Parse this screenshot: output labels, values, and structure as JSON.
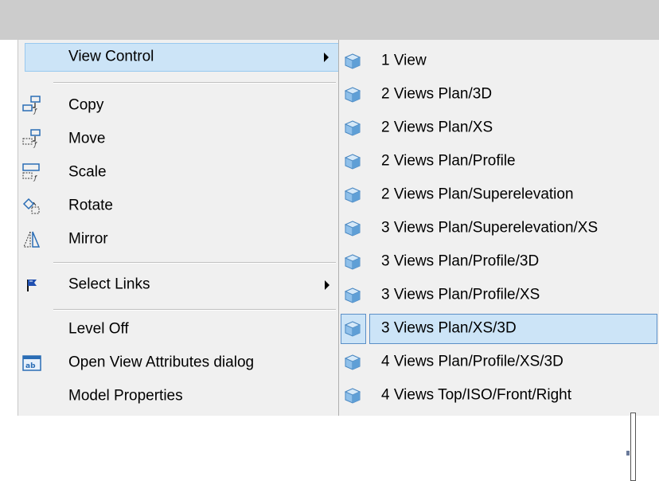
{
  "menu": {
    "items": [
      {
        "label": "View Control",
        "icon": "none",
        "submenu": true,
        "highlight": true
      },
      {
        "label": "Copy",
        "icon": "copy-icon"
      },
      {
        "label": "Move",
        "icon": "move-icon"
      },
      {
        "label": "Scale",
        "icon": "scale-icon"
      },
      {
        "label": "Rotate",
        "icon": "rotate-icon"
      },
      {
        "label": "Mirror",
        "icon": "mirror-icon"
      },
      {
        "label": "Select Links",
        "icon": "select-links-icon",
        "submenu": true
      },
      {
        "label": "Level Off",
        "icon": "none"
      },
      {
        "label": "Open View Attributes dialog",
        "icon": "view-attributes-icon"
      },
      {
        "label": "Model Properties",
        "icon": "none"
      }
    ]
  },
  "submenu": {
    "items": [
      {
        "label": "1 View"
      },
      {
        "label": "2 Views Plan/3D"
      },
      {
        "label": "2 Views Plan/XS"
      },
      {
        "label": "2 Views Plan/Profile"
      },
      {
        "label": "2 Views Plan/Superelevation"
      },
      {
        "label": "3 Views Plan/Superelevation/XS"
      },
      {
        "label": "3 Views Plan/Profile/3D"
      },
      {
        "label": "3 Views Plan/Profile/XS"
      },
      {
        "label": "3 Views Plan/XS/3D",
        "highlight": true
      },
      {
        "label": "4 Views Plan/Profile/XS/3D"
      },
      {
        "label": "4 Views Top/ISO/Front/Right"
      }
    ]
  },
  "colors": {
    "menu_bg": "#f0f0f0",
    "highlight": "#cce4f7",
    "highlight_border": "#5b8fc7",
    "cube": "#6aa6d8"
  }
}
